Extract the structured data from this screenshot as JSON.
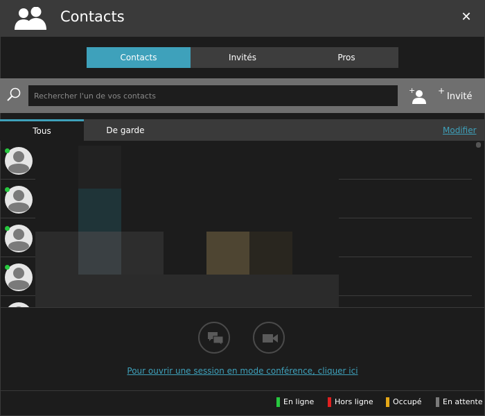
{
  "window": {
    "title": "Contacts",
    "close_label": "✕"
  },
  "segments": [
    {
      "label": "Contacts",
      "active": true
    },
    {
      "label": "Invités",
      "active": false
    },
    {
      "label": "Pros",
      "active": false
    }
  ],
  "search": {
    "placeholder": "Rechercher l'un de vos contacts",
    "value": ""
  },
  "actions": {
    "invite_plus": "+",
    "invite_label": "Invité"
  },
  "subtabs": [
    {
      "label": "Tous",
      "active": true
    },
    {
      "label": "De garde",
      "active": false
    }
  ],
  "modify_label": "Modifier",
  "contacts": [
    {
      "status": "online"
    },
    {
      "status": "online"
    },
    {
      "status": "online"
    },
    {
      "status": "online"
    },
    {
      "status": "offline"
    }
  ],
  "conference_link": "Pour ouvrir une session en mode conférence, cliquer ici",
  "legend": [
    {
      "label": "En ligne",
      "color": "#27c83f"
    },
    {
      "label": "Hors ligne",
      "color": "#e02020"
    },
    {
      "label": "Occupé",
      "color": "#e6a817"
    },
    {
      "label": "En attente",
      "color": "#7a7a7a"
    }
  ],
  "colors": {
    "accent": "#3ea1bb",
    "online": "#27c83f"
  }
}
